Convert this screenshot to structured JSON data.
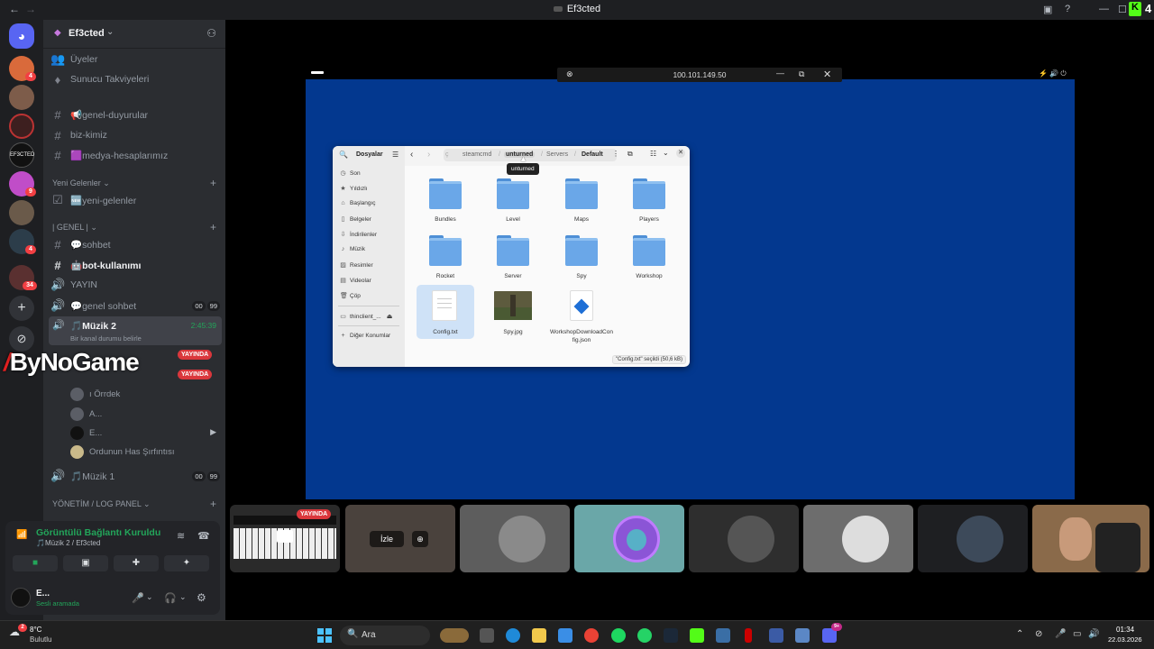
{
  "window": {
    "title": "Ef3cted"
  },
  "server": {
    "name": "Ef3cted"
  },
  "sidebar": {
    "top_items": [
      {
        "label": "Üyeler",
        "icon": "members-icon"
      },
      {
        "label": "Sunucu Takviyeleri",
        "icon": "boost-icon"
      }
    ],
    "channels_a": [
      {
        "label": "📢genel-duyurular"
      },
      {
        "label": "biz-kimiz"
      },
      {
        "label": "🟪medya-hesaplarımız"
      }
    ],
    "cat_new": "Yeni Gelenler",
    "channel_new": "🆕yeni-gelenler",
    "cat_general": "| GENEL |",
    "channels_b": [
      {
        "label": "💬sohbet"
      },
      {
        "label": "🤖bot-kullanımı"
      },
      {
        "label": "YAYIN"
      }
    ],
    "voice_general": {
      "label": "💬genel sohbet",
      "c1": "00",
      "c2": "99"
    },
    "voice_music2": {
      "label": "🎵Müzik 2",
      "time": "2:45:39",
      "status": "Bir kanal durumu belirle"
    },
    "live_label": "YAYINDA",
    "voice_users": [
      {
        "name": "ı Örrdek"
      },
      {
        "name": "A..."
      },
      {
        "name": "E..."
      },
      {
        "name": "Ordunun Has Şırfıntısı"
      }
    ],
    "voice_music1": {
      "label": "🎵Müzik 1",
      "c1": "00",
      "c2": "99"
    },
    "cat_admin": "YÖNETİM / LOG PANEL"
  },
  "watermark": "ByNoGame",
  "voice_panel": {
    "status": "Görüntülü Bağlantı Kuruldu",
    "channel": "🎵Müzik 2 / Ef3cted",
    "user": "E...",
    "user_status": "Sesli aramada"
  },
  "rdp": {
    "address": "100.101.149.50"
  },
  "file_manager": {
    "sidebar_title": "Dosyalar",
    "places": [
      {
        "label": "Son",
        "icon": "clock-icon"
      },
      {
        "label": "Yıldızlı",
        "icon": "star-icon"
      },
      {
        "label": "Başlangıç",
        "icon": "home-icon"
      },
      {
        "label": "Belgeler",
        "icon": "document-icon"
      },
      {
        "label": "İndirilenler",
        "icon": "download-icon"
      },
      {
        "label": "Müzik",
        "icon": "music-icon"
      },
      {
        "label": "Resimler",
        "icon": "image-icon"
      },
      {
        "label": "Videolar",
        "icon": "video-icon"
      },
      {
        "label": "Çöp",
        "icon": "trash-icon"
      }
    ],
    "device": "thinclient_...",
    "other_locations": "Diğer Konumlar",
    "breadcrumb": [
      "ç",
      "steamcmd",
      "unturned",
      "Servers",
      "Default"
    ],
    "tooltip": "unturned",
    "items": [
      {
        "name": "Bundles",
        "kind": "folder"
      },
      {
        "name": "Level",
        "kind": "folder"
      },
      {
        "name": "Maps",
        "kind": "folder"
      },
      {
        "name": "Players",
        "kind": "folder"
      },
      {
        "name": "Rocket",
        "kind": "folder"
      },
      {
        "name": "Server",
        "kind": "folder"
      },
      {
        "name": "Spy",
        "kind": "folder"
      },
      {
        "name": "Workshop",
        "kind": "folder"
      },
      {
        "name": "Config.txt",
        "kind": "text"
      },
      {
        "name": "Spy.jpg",
        "kind": "image"
      },
      {
        "name": "WorkshopDownloadConfig.json",
        "kind": "json"
      }
    ],
    "status": "\"Config.txt\" seçildi (50,6 kB)"
  },
  "tiles": {
    "watch_label": "İzle",
    "live_label": "YAYINDA"
  },
  "taskbar": {
    "weather_temp": "8°C",
    "weather_desc": "Bulutlu",
    "search_placeholder": "Ara",
    "time": "01:34",
    "date": "22.03.2026"
  },
  "colors": {
    "remote_bg": "#03388f",
    "discord_bg": "#2b2d31",
    "live_red": "#da373c",
    "accent_green": "#23a55a"
  }
}
